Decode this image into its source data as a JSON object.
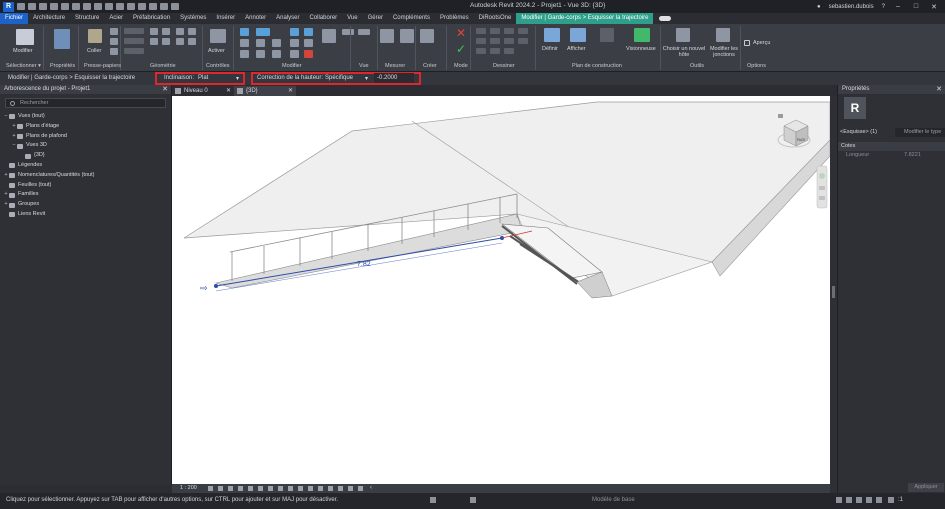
{
  "titlebar": {
    "title": "Autodesk Revit 2024.2 - Projet1 - Vue 3D: {3D}",
    "user": "sebastien.dubois",
    "logo": "R"
  },
  "tabs": [
    "Fichier",
    "Architecture",
    "Structure",
    "Acier",
    "Préfabrication",
    "Systèmes",
    "Insérer",
    "Annoter",
    "Analyser",
    "Collaborer",
    "Vue",
    "Gérer",
    "Compléments",
    "Problèmes",
    "DiRootsOne"
  ],
  "context_tab": "Modifier | Garde-corps > Esquisser la trajectoire",
  "ribbon": {
    "modifier": "Modifier",
    "coller": "Coller",
    "activer": "Activer",
    "definir": "Définir",
    "afficher": "Afficher",
    "visionneuse": "Visionneuse",
    "choisir_hote": "Choisir un nouvel hôte",
    "modifier_jonctions": "Modifier les jonctions",
    "apercu": "Aperçu",
    "panels": [
      "Sélectionner ▾",
      "Propriétés",
      "Presse-papiers",
      "Géométrie",
      "Contrôles",
      "Modifier",
      "Vue",
      "Mesurer",
      "Créer",
      "Mode",
      "Dessiner",
      "Plan de construction",
      "Outils",
      "Options"
    ]
  },
  "options_bar": {
    "breadcrumb": "Modifier | Garde-corps > Esquisser la trajectoire",
    "inclinaison_label": "Inclinaison:",
    "inclinaison_value": "Plat",
    "correction_label": "Correction de la hauteur:",
    "correction_value": "Spécifique",
    "offset_value": "-0.2000"
  },
  "browser": {
    "title": "Arborescence du projet - Projet1",
    "search_placeholder": "Rechercher",
    "items": [
      {
        "label": "Vues (tout)",
        "exp": "−",
        "indent": 0
      },
      {
        "label": "Plans d'étage",
        "exp": "+",
        "indent": 1
      },
      {
        "label": "Plans de plafond",
        "exp": "+",
        "indent": 1
      },
      {
        "label": "Vues 3D",
        "exp": "−",
        "indent": 1
      },
      {
        "label": "{3D}",
        "exp": "",
        "indent": 2
      },
      {
        "label": "Légendes",
        "exp": "",
        "indent": 0
      },
      {
        "label": "Nomenclatures/Quantités (tout)",
        "exp": "+",
        "indent": 0
      },
      {
        "label": "Feuilles (tout)",
        "exp": "",
        "indent": 0
      },
      {
        "label": "Familles",
        "exp": "+",
        "indent": 0
      },
      {
        "label": "Groupes",
        "exp": "+",
        "indent": 0
      },
      {
        "label": "Liens Revit",
        "exp": "",
        "indent": 0
      }
    ]
  },
  "view_tabs": [
    {
      "label": "Niveau 0",
      "active": false
    },
    {
      "label": "{3D}",
      "active": true
    }
  ],
  "canvas": {
    "dimension": "7.82",
    "cube_label": "FACE"
  },
  "viewbar": {
    "scale": "1 : 200"
  },
  "properties": {
    "title": "Propriétés",
    "logo": "R",
    "selector": "<Esquisse> (1)",
    "edit_type": "Modifier le type",
    "group": "Cotes",
    "row_label": "Longueur",
    "row_value": "7.8221",
    "apply": "Appliquer"
  },
  "statusbar": {
    "message": "Cliquez pour sélectionner. Appuyez sur TAB pour afficher d'autres options, sur CTRL pour ajouter et sur MAJ pour désactiver.",
    "model": "Modèle de base",
    "filter": ":1"
  }
}
